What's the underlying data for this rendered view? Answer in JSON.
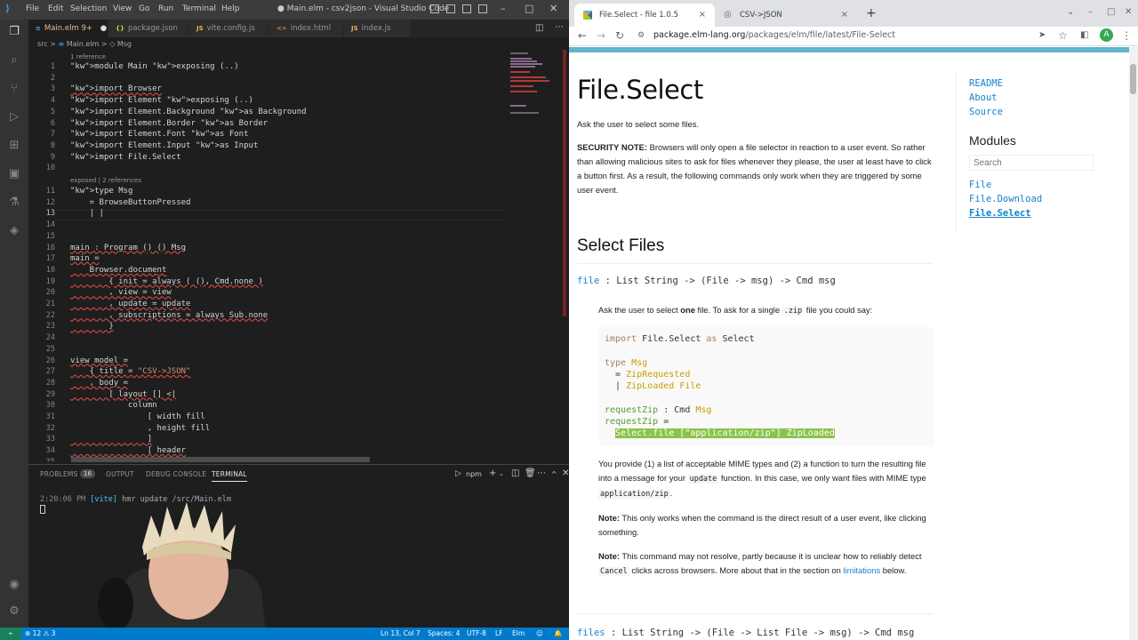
{
  "vscode": {
    "menu": [
      "File",
      "Edit",
      "Selection",
      "View",
      "Go",
      "Run",
      "Terminal",
      "Help"
    ],
    "title": "● Main.elm - csv2json - Visual Studio Code",
    "tabs": [
      {
        "label": "Main.elm",
        "suffix": "9+",
        "icon": "elm",
        "modified": "●"
      },
      {
        "label": "package.json",
        "icon": "{}"
      },
      {
        "label": "vite.config.js",
        "icon": "JS"
      },
      {
        "label": "index.html",
        "icon": "<>"
      },
      {
        "label": "index.js",
        "icon": "JS"
      }
    ],
    "breadcrumb": [
      "src",
      ">",
      "Main.elm",
      ">",
      "Msg"
    ],
    "codelens": [
      "1 reference",
      "exposed | 2 references"
    ],
    "lines": [
      {
        "n": "1",
        "text": "module Main exposing (..)"
      },
      {
        "n": "2",
        "text": ""
      },
      {
        "n": "3",
        "text": "import Browser"
      },
      {
        "n": "4",
        "text": "import Element exposing (..)"
      },
      {
        "n": "5",
        "text": "import Element.Background as Background"
      },
      {
        "n": "6",
        "text": "import Element.Border as Border"
      },
      {
        "n": "7",
        "text": "import Element.Font as Font"
      },
      {
        "n": "8",
        "text": "import Element.Input as Input"
      },
      {
        "n": "9",
        "text": "import File.Select"
      },
      {
        "n": "10",
        "text": ""
      },
      {
        "n": "11",
        "text": "type Msg"
      },
      {
        "n": "12",
        "text": "    = BrowseButtonPressed"
      },
      {
        "n": "13",
        "text": "    | |"
      },
      {
        "n": "14",
        "text": ""
      },
      {
        "n": "15",
        "text": ""
      },
      {
        "n": "16",
        "text": "main : Program () () Msg"
      },
      {
        "n": "17",
        "text": "main ="
      },
      {
        "n": "18",
        "text": "    Browser.document"
      },
      {
        "n": "19",
        "text": "        { init = always ( (), Cmd.none )"
      },
      {
        "n": "20",
        "text": "        , view = view"
      },
      {
        "n": "21",
        "text": "        , update = update"
      },
      {
        "n": "22",
        "text": "        , subscriptions = always Sub.none"
      },
      {
        "n": "23",
        "text": "        }"
      },
      {
        "n": "24",
        "text": ""
      },
      {
        "n": "25",
        "text": ""
      },
      {
        "n": "26",
        "text": "view model ="
      },
      {
        "n": "27",
        "text": "    { title = \"CSV->JSON\""
      },
      {
        "n": "28",
        "text": "    , body ="
      },
      {
        "n": "29",
        "text": "        [ layout [] <|"
      },
      {
        "n": "30",
        "text": "            column"
      },
      {
        "n": "31",
        "text": "                [ width fill"
      },
      {
        "n": "32",
        "text": "                , height fill"
      },
      {
        "n": "33",
        "text": "                ]"
      },
      {
        "n": "34",
        "text": "                [ header"
      },
      {
        "n": "35",
        "text": "                    content"
      }
    ],
    "panel": {
      "tabs": [
        "PROBLEMS",
        "OUTPUT",
        "DEBUG CONSOLE",
        "TERMINAL"
      ],
      "problems_count": "16",
      "shell": "npm",
      "terminal_time": "2:20:06 PM",
      "terminal_tag": "[vite]",
      "terminal_msg": "hmr update /src/Main.elm"
    },
    "status": {
      "errors": "⊗ 12 ⚠ 3",
      "position": "Ln 13, Col 7",
      "spaces": "Spaces: 4",
      "encoding": "UTF-8",
      "eol": "LF",
      "language": "Elm"
    }
  },
  "browser": {
    "tabs": [
      {
        "label": "File.Select - file 1.0.5",
        "close": "×"
      },
      {
        "label": "CSV->JSON",
        "close": "×"
      }
    ],
    "new_tab": "+",
    "url_host": "package.elm-lang.org",
    "url_path": "/packages/elm/file/latest/File-Select",
    "avatar": "A",
    "page": {
      "title": "File.Select",
      "intro": "Ask the user to select some files.",
      "security_label": "SECURITY NOTE:",
      "security_text": "Browsers will only open a file selector in reaction to a user event. So rather than allowing malicious sites to ask for files whenever they please, the user at least have to click a button first. As a result, the following commands only work when they are triggered by some user event.",
      "section": "Select Files",
      "sig_file_name": "file",
      "sig_file": " : List String -> (File -> msg) -> Cmd msg",
      "file_desc_1": "Ask the user to select ",
      "file_desc_bold": "one",
      "file_desc_2": " file. To ask for a single ",
      "file_desc_code": ".zip",
      "file_desc_3": " file you could say:",
      "code": [
        "import File.Select as Select",
        "",
        "type Msg",
        "  = ZipRequested",
        "  | ZipLoaded File",
        "",
        "requestZip : Cmd Msg",
        "requestZip =",
        "  Select.file [\"application/zip\"] ZipLoaded"
      ],
      "provide_1": "You provide (1) a list of acceptable MIME types and (2) a function to turn the resulting file into a message for your ",
      "provide_code": "update",
      "provide_2": " function. In this case, we only want files with MIME type ",
      "provide_code2": "application/zip",
      "provide_3": ".",
      "note1_label": "Note:",
      "note1_text": "This only works when the command is the direct result of a user event, like clicking something.",
      "note2_label": "Note:",
      "note2_text_1": "This command may not resolve, partly because it is unclear how to reliably detect ",
      "note2_code": "Cancel",
      "note2_text_2": " clicks across browsers. More about that in the section on ",
      "note2_link": "limitations",
      "note2_text_3": "below.",
      "sig_files_name": "files",
      "sig_files": " : List String -> (File -> List File -> msg) -> Cmd msg",
      "sidebar_links": [
        "README",
        "About",
        "Source"
      ],
      "modules_heading": "Modules",
      "search_placeholder": "Search",
      "module_links": [
        "File",
        "File.Download",
        "File.Select"
      ]
    }
  }
}
